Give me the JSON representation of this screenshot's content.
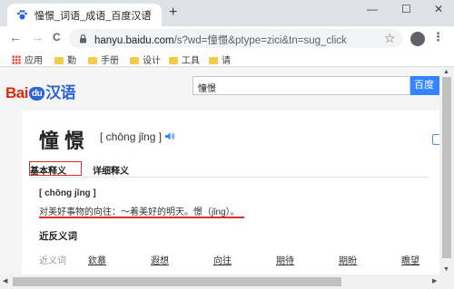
{
  "browser": {
    "tab_title": "憧憬_词语_成语_百度汉语",
    "tab_close": "×",
    "new_tab": "+",
    "window_controls": {
      "minimize": "—",
      "maximize": "☐",
      "close": "✕"
    },
    "nav": {
      "back": "←",
      "forward": "→",
      "reload": "C"
    },
    "url_host": "hanyu.baidu.com",
    "url_path": "/s?wd=憧憬&ptype=zici&tn=sug_click",
    "star": "☆",
    "menu": "⋮",
    "bookmarks": [
      {
        "label": "应用",
        "icon": "apps-grid-icon"
      },
      {
        "label": "勤",
        "icon": "folder-icon"
      },
      {
        "label": "手册",
        "icon": "folder-icon"
      },
      {
        "label": "设计",
        "icon": "folder-icon"
      },
      {
        "label": "工具",
        "icon": "folder-icon"
      },
      {
        "label": "请",
        "icon": "folder-icon"
      }
    ]
  },
  "site": {
    "logo_bai": "Bai",
    "logo_du": "du",
    "logo_hanyu": "汉语",
    "search_value": "憧憬",
    "search_button": "百度"
  },
  "entry": {
    "word": "憧憬",
    "pinyin": "[ chōng jǐng ]",
    "tabs": {
      "basic": "基本释义",
      "detail": "详细释义"
    },
    "definition_pinyin": "[ chōng jǐng ]",
    "definition_text": "对美好事物的向往：～着美好的明天。憬（jǐng）。",
    "antonyms_title": "近反义词",
    "antonyms_label": "近义词",
    "antonyms": [
      "欽慕",
      "遐想",
      "向往",
      "期待",
      "期盼",
      "瞻望"
    ]
  },
  "colors": {
    "accent_blue": "#3385ff",
    "highlight_red": "#d93025",
    "logo_red": "#de2910",
    "logo_blue": "#2b63d9"
  }
}
